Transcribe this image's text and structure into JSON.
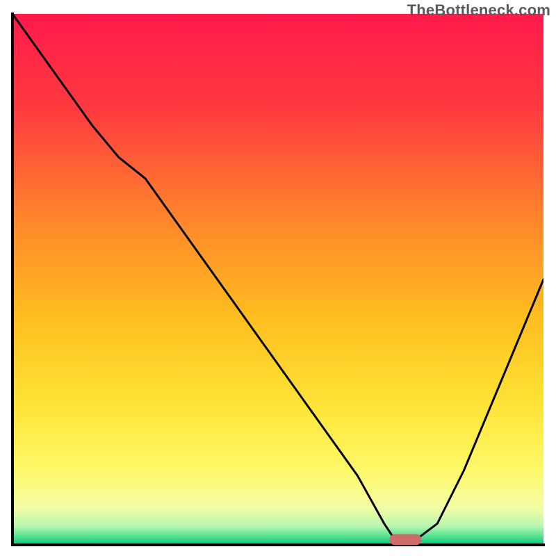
{
  "watermark": "TheBottleneck.com",
  "chart_data": {
    "type": "line",
    "title": "",
    "xlabel": "",
    "ylabel": "",
    "xlim": [
      0,
      100
    ],
    "ylim": [
      0,
      100
    ],
    "series": [
      {
        "name": "bottleneck-curve",
        "x": [
          0,
          5,
          10,
          15,
          20,
          25,
          30,
          35,
          40,
          45,
          50,
          55,
          60,
          65,
          70,
          72,
          76,
          80,
          85,
          90,
          95,
          100
        ],
        "y": [
          100,
          93,
          86,
          79,
          73,
          69,
          62,
          55,
          48,
          41,
          34,
          27,
          20,
          13,
          4,
          1,
          1,
          4,
          14,
          26,
          38,
          50
        ]
      }
    ],
    "marker": {
      "name": "optimal-point",
      "x": 74,
      "y": 1,
      "color": "#cf6b6b"
    },
    "background": {
      "type": "vertical-gradient",
      "stops": [
        {
          "pos": 0.0,
          "color": "#ff1a4b"
        },
        {
          "pos": 0.18,
          "color": "#ff3a3f"
        },
        {
          "pos": 0.4,
          "color": "#ff8a2a"
        },
        {
          "pos": 0.58,
          "color": "#ffc020"
        },
        {
          "pos": 0.74,
          "color": "#ffe438"
        },
        {
          "pos": 0.86,
          "color": "#fef96a"
        },
        {
          "pos": 0.93,
          "color": "#f4fca5"
        },
        {
          "pos": 0.965,
          "color": "#b7f7b0"
        },
        {
          "pos": 0.985,
          "color": "#4de08f"
        },
        {
          "pos": 1.0,
          "color": "#00c87a"
        }
      ]
    },
    "frame_color": "#000000",
    "curve_stroke": "#000000",
    "curve_width": 3
  }
}
